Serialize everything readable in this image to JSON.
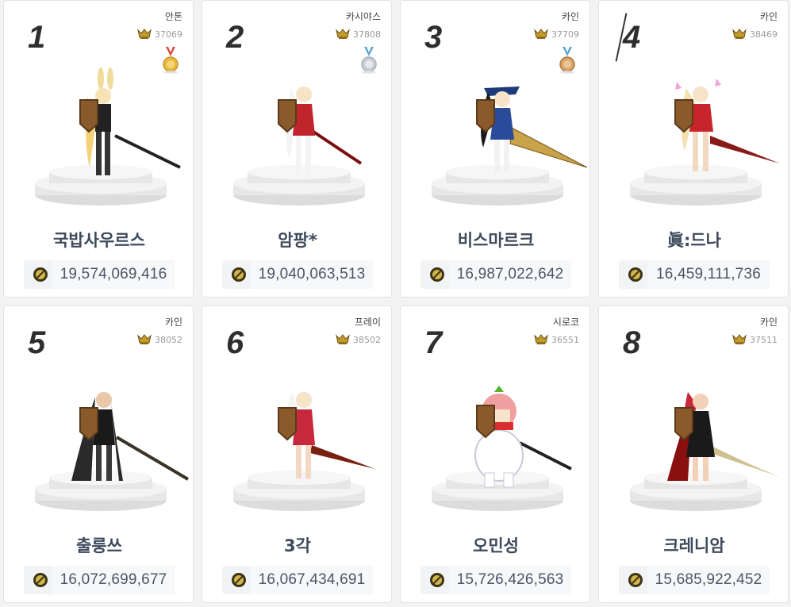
{
  "rankings": [
    {
      "rank": "1",
      "server": "안톤",
      "score": "37069",
      "medal": "gold",
      "name": "국밥사우르스",
      "fame": "19,574,069,416",
      "char": "bunny"
    },
    {
      "rank": "2",
      "server": "카시야스",
      "score": "37808",
      "medal": "silver",
      "name": "암팡*",
      "fame": "19,040,063,513",
      "char": "white"
    },
    {
      "rank": "3",
      "server": "카인",
      "score": "37709",
      "medal": "bronze",
      "name": "비스마르크",
      "fame": "16,987,022,642",
      "char": "navy"
    },
    {
      "rank": "4",
      "server": "카인",
      "score": "38469",
      "medal": "",
      "name": "眞:드나",
      "fame": "16,459,111,736",
      "char": "blonde"
    },
    {
      "rank": "5",
      "server": "카인",
      "score": "38052",
      "medal": "",
      "name": "출룽쓰",
      "fame": "16,072,699,677",
      "char": "dark"
    },
    {
      "rank": "6",
      "server": "프레이",
      "score": "38502",
      "medal": "",
      "name": "3각",
      "fame": "16,067,434,691",
      "char": "kimono"
    },
    {
      "rank": "7",
      "server": "시로코",
      "score": "36551",
      "medal": "",
      "name": "오민성",
      "fame": "15,726,426,563",
      "char": "snowman"
    },
    {
      "rank": "8",
      "server": "카인",
      "score": "37511",
      "medal": "",
      "name": "크레니암",
      "fame": "15,685,922,452",
      "char": "red"
    }
  ],
  "colors": {
    "gold": "#e8b93a",
    "silver": "#c9ced6",
    "bronze": "#d7a36a",
    "ribbon_gold": "#d94a3d",
    "ribbon_blue": "#5aa6d6"
  }
}
